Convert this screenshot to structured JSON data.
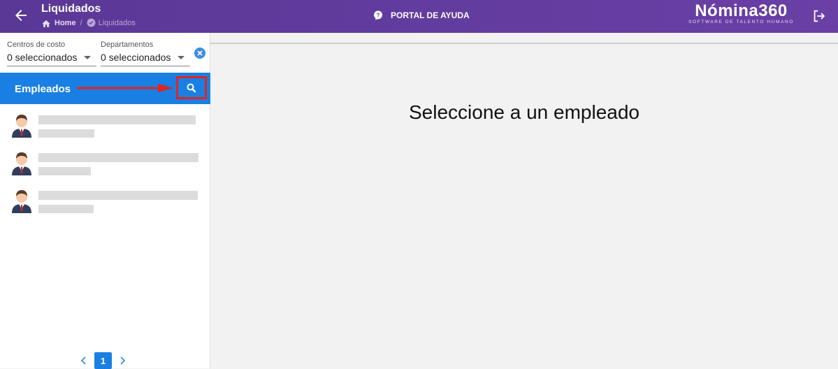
{
  "header": {
    "title": "Liquidados",
    "breadcrumb_home": "Home",
    "breadcrumb_separator": "/",
    "breadcrumb_current": "Liquidados",
    "help_label": "PORTAL DE AYUDA",
    "logo_main": "Nómina360",
    "logo_sub": "SOFTWARE DE TALENTO HUMANO",
    "bar_color": "#5a3896"
  },
  "filters": {
    "cost_centers_label": "Centros de costo",
    "cost_centers_value": "0 seleccionados",
    "departments_label": "Departamentos",
    "departments_value": "0 seleccionados"
  },
  "employees": {
    "title": "Empleados",
    "header_color": "#1a7fe3",
    "highlight_color": "#e0241f",
    "items": [
      {
        "icon": "employee-avatar-icon"
      },
      {
        "icon": "employee-avatar-icon"
      },
      {
        "icon": "employee-avatar-icon"
      }
    ]
  },
  "pagination": {
    "current_page": "1"
  },
  "main": {
    "message": "Seleccione a un empleado"
  }
}
